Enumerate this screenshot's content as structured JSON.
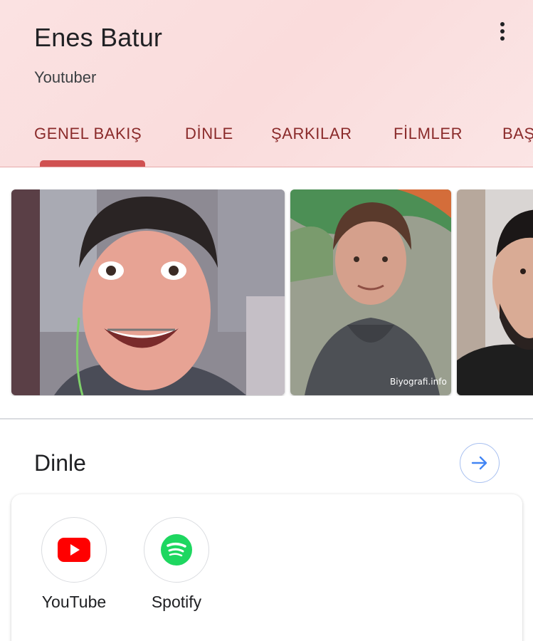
{
  "header": {
    "title": "Enes Batur",
    "subtitle": "Youtuber",
    "menu_icon": "more-vert-icon"
  },
  "tabs": [
    {
      "label": "GENEL BAKIŞ",
      "selected": true
    },
    {
      "label": "DİNLE",
      "selected": false
    },
    {
      "label": "ŞARKILAR",
      "selected": false
    },
    {
      "label": "FİLMLER",
      "selected": false
    },
    {
      "label": "BAŞ",
      "selected": false
    }
  ],
  "images": {
    "watermark": "Biyografi.info"
  },
  "listen": {
    "title": "Dinle",
    "more_icon": "arrow-right-icon",
    "apps": [
      {
        "label": "YouTube",
        "icon": "youtube-icon"
      },
      {
        "label": "Spotify",
        "icon": "spotify-icon"
      }
    ]
  },
  "colors": {
    "header_bg": "#fbe2e2",
    "tab_text": "#8a2a2a",
    "tab_indicator": "#d05151",
    "arrow_blue": "#4285f4",
    "youtube_red": "#ff0000",
    "spotify_green": "#1ed760"
  }
}
